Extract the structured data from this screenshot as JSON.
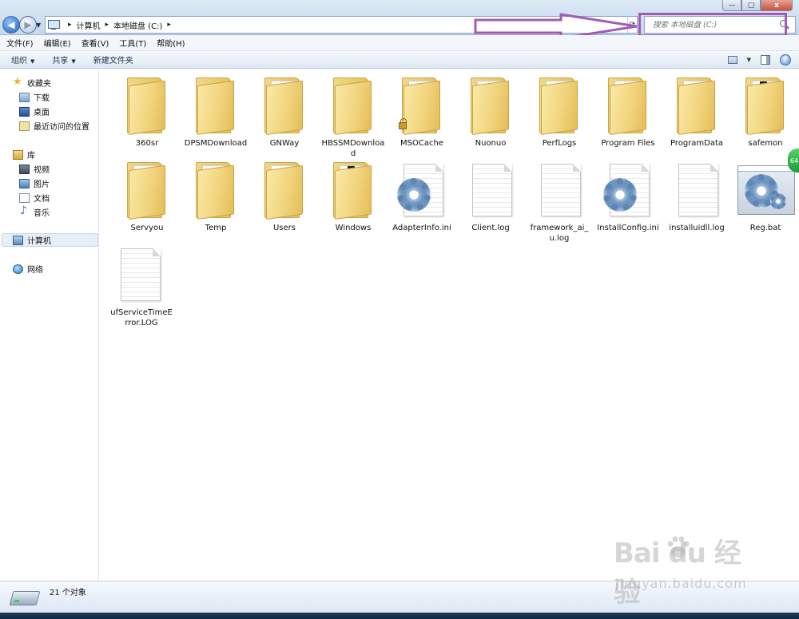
{
  "window": {
    "minimize_glyph": "—",
    "maximize_glyph": "▢",
    "close_glyph": "x"
  },
  "address_bar": {
    "crumbs": [
      "计算机",
      "本地磁盘 (C:)"
    ],
    "search_placeholder": "搜索 本地磁盘 (C:)"
  },
  "menu": [
    "文件(F)",
    "编辑(E)",
    "查看(V)",
    "工具(T)",
    "帮助(H)"
  ],
  "toolbar": {
    "organize": "组织",
    "share": "共享",
    "new_folder": "新建文件夹"
  },
  "nav_pane": {
    "favorites": "收藏夹",
    "downloads": "下载",
    "desktop": "桌面",
    "recent": "最近访问的位置",
    "libraries": "库",
    "videos": "视频",
    "pictures": "图片",
    "documents": "文档",
    "music": "音乐",
    "computer": "计算机",
    "network": "网络"
  },
  "items": [
    {
      "name": "360sr",
      "kind": "folder"
    },
    {
      "name": "DPSMDownload",
      "kind": "folder"
    },
    {
      "name": "GNWay",
      "kind": "folder"
    },
    {
      "name": "HBSSMDownload",
      "kind": "folder"
    },
    {
      "name": "MSOCache",
      "kind": "folder-locked"
    },
    {
      "name": "Nuonuo",
      "kind": "folder"
    },
    {
      "name": "PerfLogs",
      "kind": "folder"
    },
    {
      "name": "Program Files",
      "kind": "folder"
    },
    {
      "name": "ProgramData",
      "kind": "folder"
    },
    {
      "name": "safemon",
      "kind": "folder"
    },
    {
      "name": "Servyou",
      "kind": "folder"
    },
    {
      "name": "Temp",
      "kind": "folder"
    },
    {
      "name": "Users",
      "kind": "folder"
    },
    {
      "name": "Windows",
      "kind": "folder"
    },
    {
      "name": "AdapterInfo.ini",
      "kind": "config-file"
    },
    {
      "name": "Client.log",
      "kind": "text-file"
    },
    {
      "name": "framework_ai_u.log",
      "kind": "text-file"
    },
    {
      "name": "InstallConfig.ini",
      "kind": "config-file"
    },
    {
      "name": "installuidll.log",
      "kind": "text-file"
    },
    {
      "name": "Reg.bat",
      "kind": "batch-file"
    },
    {
      "name": "ufServiceTimeError.LOG",
      "kind": "text-file"
    }
  ],
  "status": {
    "object_count": "21 个对象"
  },
  "side_badge": "64",
  "watermark": {
    "brand": "Bai  du 经验",
    "url": "jingyan.baidu.com"
  },
  "colors": {
    "annotation": "#a25ab5",
    "folder": "#f0d27a",
    "chrome": "#dce9f5"
  }
}
